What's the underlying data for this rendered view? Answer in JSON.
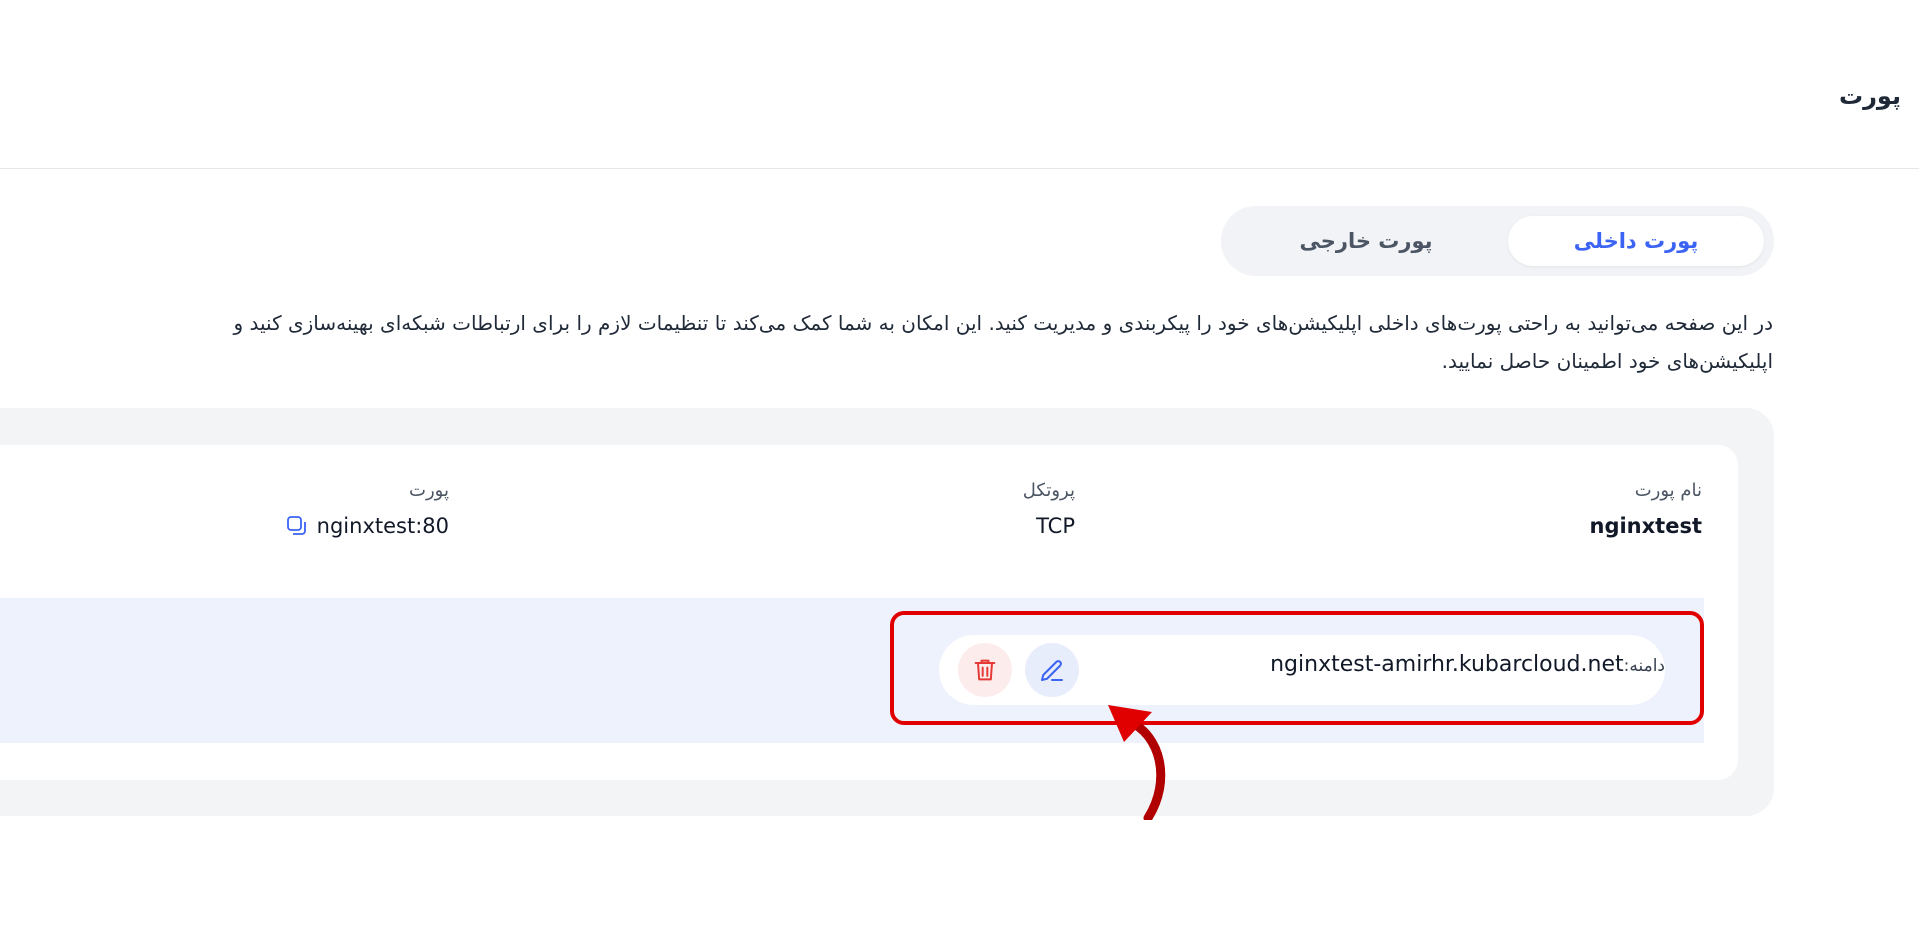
{
  "header": {
    "title": "پورت"
  },
  "tabs": [
    {
      "label": "پورت داخلی",
      "active": true
    },
    {
      "label": "پورت خارجی",
      "active": false
    }
  ],
  "description": {
    "line1": "در این صفحه می‌توانید به راحتی پورت‌های داخلی اپلیکیشن‌های خود را پیکربندی و مدیریت کنید. این امکان به شما کمک می‌کند تا تنظیمات لازم را برای ارتباطات شبکه‌ای بهینه‌سازی کنید و",
    "line2": "اپلیکیشن‌های خود اطمینان حاصل نمایید."
  },
  "port_item": {
    "name_label": "نام پورت",
    "name_value": "nginxtest",
    "protocol_label": "پروتکل",
    "protocol_value": "TCP",
    "port_label": "پورت",
    "port_value": "nginxtest:80"
  },
  "domain": {
    "label": "دامنه:",
    "value": "nginxtest-amirhr.kubarcloud.net"
  },
  "icons": {
    "copy": "copy-icon",
    "edit": "pencil-icon",
    "delete": "trash-icon"
  },
  "colors": {
    "accent": "#3b63f4",
    "danger": "#e53935",
    "highlight": "#e00000",
    "arrow": "#b00000"
  }
}
